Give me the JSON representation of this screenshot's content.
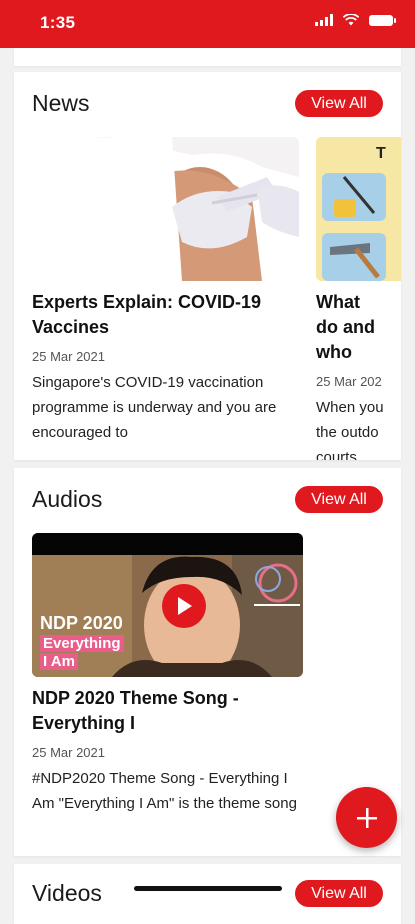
{
  "status_bar": {
    "time": "1:35"
  },
  "news": {
    "title": "News",
    "view_all_label": "View All",
    "items": [
      {
        "title": "Experts Explain: COVID-19 Vaccines",
        "date": "25 Mar 2021",
        "description": "Singapore's COVID-19 vaccination programme is underway and you are encouraged to"
      },
      {
        "title": "What do and who",
        "date": "25 Mar 202",
        "description": "When you the outdo courts,",
        "image_text": "T"
      }
    ]
  },
  "audios": {
    "title": "Audios",
    "view_all_label": "View All",
    "items": [
      {
        "title": "NDP 2020 Theme Song - Everything I",
        "date": "25 Mar 2021",
        "description": "#NDP2020 Theme Song - Everything I Am \"Everything I Am\" is the theme song",
        "thumb_text_line1": "NDP 2020",
        "thumb_text_line2": "Everything",
        "thumb_text_line3": "I Am"
      }
    ]
  },
  "videos": {
    "title": "Videos",
    "view_all_label": "View All"
  },
  "fab_icon": "plus-icon",
  "colors": {
    "accent": "#e0191f"
  }
}
